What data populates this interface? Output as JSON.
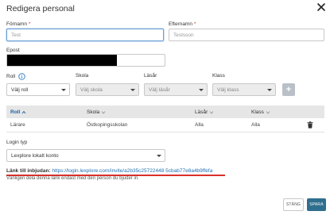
{
  "dialog": {
    "title": "Redigera personal"
  },
  "form": {
    "first_name": {
      "label": "Förnamn",
      "required_mark": "*",
      "placeholder": "Test"
    },
    "last_name": {
      "label": "Efternamn",
      "required_mark": "*",
      "placeholder": "Testsson"
    },
    "email": {
      "label": "Epost"
    },
    "role": {
      "label": "Roll",
      "value": "Välj roll"
    },
    "school": {
      "label": "Skola",
      "value": "Välj skola"
    },
    "school_year": {
      "label": "Läsår",
      "value": "Välj läsår"
    },
    "class": {
      "label": "Klass",
      "value": "Välj klass"
    },
    "add_label": "+"
  },
  "table": {
    "headers": [
      "Roll",
      "Skola",
      "Läsår",
      "Klass"
    ],
    "rows": [
      {
        "role": "Lärare",
        "school": "Östkopingsskolan",
        "year": "Alla",
        "class": "Alla"
      }
    ]
  },
  "login": {
    "label": "Login typ",
    "value": "Lexplore lokalt konto"
  },
  "invite": {
    "label": "Länk till inbjudan:",
    "url": "https://login.lexplore.com/invite/a2b35c25722448 5cbab77e8a4b9ffefa",
    "note": "Vänligen dela denna länk endast med den person du bjuder in."
  },
  "footer": {
    "close_label": "STÄNG",
    "save_label": "SPARA"
  },
  "colors": {
    "accent": "#2f6e8e",
    "link": "#1f6fb5",
    "underline": "#d9302a"
  }
}
